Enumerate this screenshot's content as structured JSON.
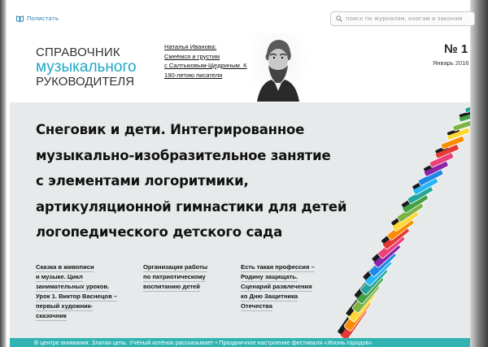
{
  "toolbar": {
    "browse_label": "Полистать",
    "search_placeholder": "поиск по журналам, книгам и законам"
  },
  "logo": {
    "line1": "СПРАВОЧНИК",
    "line2": "музыкального",
    "line3": "РУКОВОДИТЕЛЯ"
  },
  "announcement": {
    "lines": [
      "Наталья Иванова:",
      "Смеёмся и грустим",
      "с Салтыковым-Щедриным. К",
      "190-летию писателя"
    ]
  },
  "issue": {
    "number": "№ 1",
    "date": "Январь 2016"
  },
  "feature": {
    "headline_lines": [
      "Снеговик и дети. Интегрированное",
      "музыкально-изобразительное занятие",
      "с элементами логоритмики,",
      "артикуляционной гимнастики для детей",
      "логопедического детского сада"
    ]
  },
  "articles": [
    {
      "lines": [
        "Сказка в живописи",
        "и музыке. Цикл",
        "занимательных уроков.",
        "Урок 1. Виктор Васнецов –",
        "первый художник-",
        "сказочник"
      ]
    },
    {
      "lines": [
        "Организация работы",
        "по патриотическому",
        "воспитанию детей"
      ]
    },
    {
      "lines": [
        "Есть такая профессия –",
        "Родину защищать.",
        "Сценарий развлечения",
        "ко Дню Защитника",
        "Отечества"
      ]
    }
  ],
  "ticker": {
    "text": "В центре внимания: Златая цепь. Учёный котёнок рассказывает  •  Праздничное настроение фестиваля «Жизнь городов»"
  },
  "colors": {
    "accent": "#1ea7c6",
    "feature_bg": "#e7eaeb",
    "ticker_bg": "#2fb4b3"
  }
}
